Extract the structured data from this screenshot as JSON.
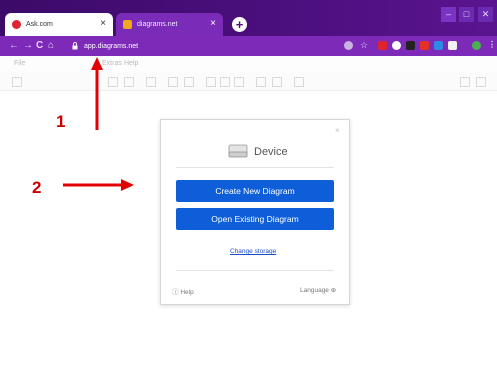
{
  "browser": {
    "tabs": [
      {
        "label": "Ask.com",
        "close": "×",
        "favicon_color": "#e0242f"
      },
      {
        "label": "diagrams.net",
        "close": "×",
        "favicon_color": "#f2a81d"
      }
    ],
    "new_tab": "+",
    "window_controls": {
      "minimize": "–",
      "maximize": "□",
      "close": "✕"
    },
    "nav": {
      "back": "←",
      "forward": "→",
      "reload": "C",
      "home": "⌂"
    },
    "url": "app.diagrams.net",
    "colors": {
      "tabstrip": "#4b0f7d",
      "toolbar": "#7d2ab9"
    }
  },
  "app": {
    "menu": [
      "File",
      "Extras",
      "Help"
    ],
    "dialog": {
      "close": "×",
      "storage_label": "Device",
      "create_button": "Create New Diagram",
      "open_button": "Open Existing Diagram",
      "change_storage": "Change storage",
      "help": "Help",
      "language": "Language",
      "button_color": "#0d5ed8"
    }
  },
  "annotations": {
    "label_1": "1",
    "label_2": "2",
    "color": "#e30000"
  }
}
